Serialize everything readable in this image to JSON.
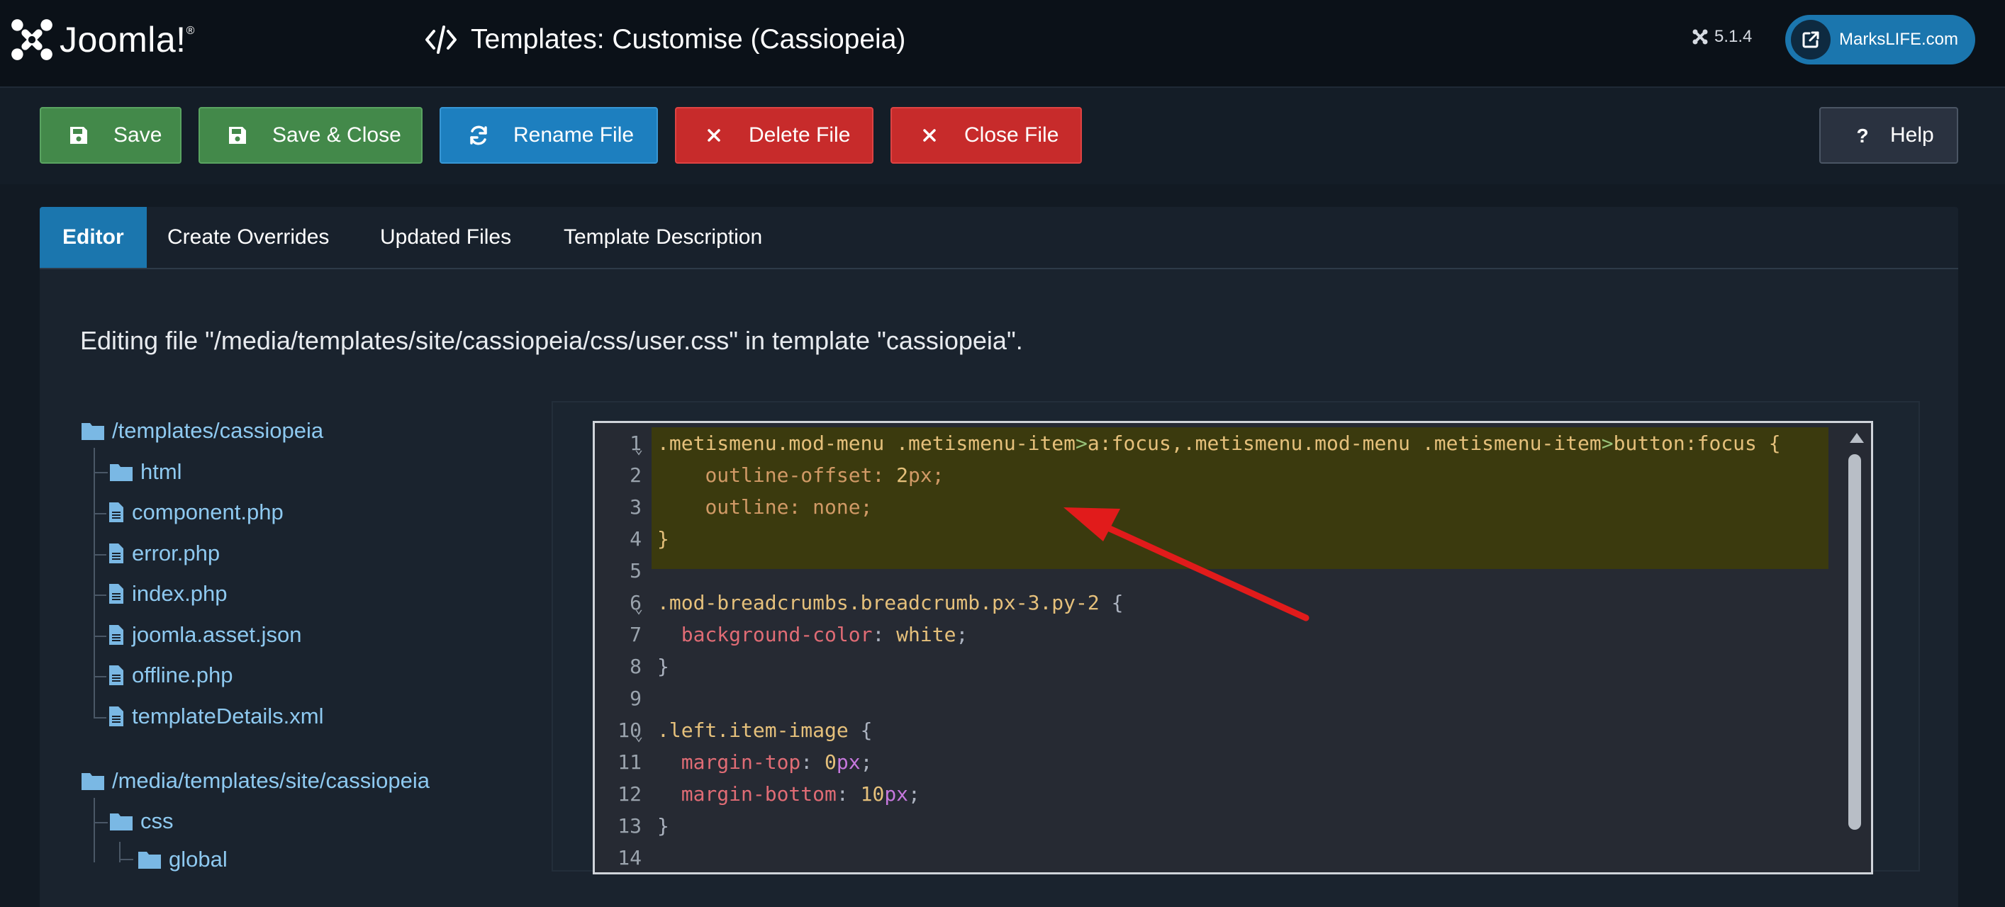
{
  "header": {
    "logo_text": "Joomla!",
    "logo_reg": "®",
    "page_title": "Templates: Customise (Cassiopeia)",
    "version": "5.1.4",
    "site_link": "MarksLIFE.com"
  },
  "toolbar": {
    "save": "Save",
    "save_close": "Save & Close",
    "rename": "Rename File",
    "delete": "Delete File",
    "close": "Close File",
    "help": "Help"
  },
  "tabs": [
    "Editor",
    "Create Overrides",
    "Updated Files",
    "Template Description"
  ],
  "editing_text": "Editing file \"/media/templates/site/cassiopeia/css/user.css\" in template \"cassiopeia\".",
  "tree": {
    "root1": "/templates/cassiopeia",
    "root1_items": [
      "html",
      "component.php",
      "error.php",
      "index.php",
      "joomla.asset.json",
      "offline.php",
      "templateDetails.xml"
    ],
    "root2": "/media/templates/site/cassiopeia",
    "root2_items": [
      "css",
      "global"
    ]
  },
  "code": {
    "line_numbers": [
      "1",
      "2",
      "3",
      "4",
      "5",
      "6",
      "7",
      "8",
      "9",
      "10",
      "11",
      "12",
      "13",
      "14"
    ],
    "l1_sel_a": ".metismenu.mod-menu .metismenu-item",
    "l1_op_a": ">",
    "l1_sel_b": "a:focus,.metismenu.mod-menu .metismenu-item",
    "l1_op_b": ">",
    "l1_sel_c": "button:focus {",
    "l2_indent": "    ",
    "l2_prop": "outline-offset",
    "l2_colon": ": ",
    "l2_num": "2",
    "l2_unit": "px",
    "l2_end": ";",
    "l3_indent": "    ",
    "l3_prop": "outline",
    "l3_colon": ": ",
    "l3_val": "none",
    "l3_end": ";",
    "l4": "}",
    "l6_sel": ".mod-breadcrumbs.breadcrumb.px-3.py-2",
    "l6_brace": " {",
    "l7_indent": "  ",
    "l7_prop": "background-color",
    "l7_colon": ": ",
    "l7_val": "white",
    "l7_end": ";",
    "l8": "}",
    "l10_sel": ".left.item-image",
    "l10_brace": " {",
    "l11_indent": "  ",
    "l11_prop": "margin-top",
    "l11_colon": ": ",
    "l11_num": "0",
    "l11_unit": "px",
    "l11_end": ";",
    "l12_indent": "  ",
    "l12_prop": "margin-bottom",
    "l12_colon": ": ",
    "l12_num": "10",
    "l12_unit": "px",
    "l12_end": ";",
    "l13": "}",
    "fold_marker": "⌄"
  },
  "colors": {
    "accent_blue": "#1b76ae",
    "save_green": "#43894a",
    "danger_red": "#c72b2b",
    "arrow_red": "#e11b1b",
    "highlight": "#3b3a0e"
  },
  "icons": [
    "joomla-logo-icon",
    "code-icon",
    "joomla-small-icon",
    "external-link-icon",
    "save-icon",
    "sync-icon",
    "times-icon",
    "question-icon",
    "folder-icon",
    "file-icon"
  ]
}
